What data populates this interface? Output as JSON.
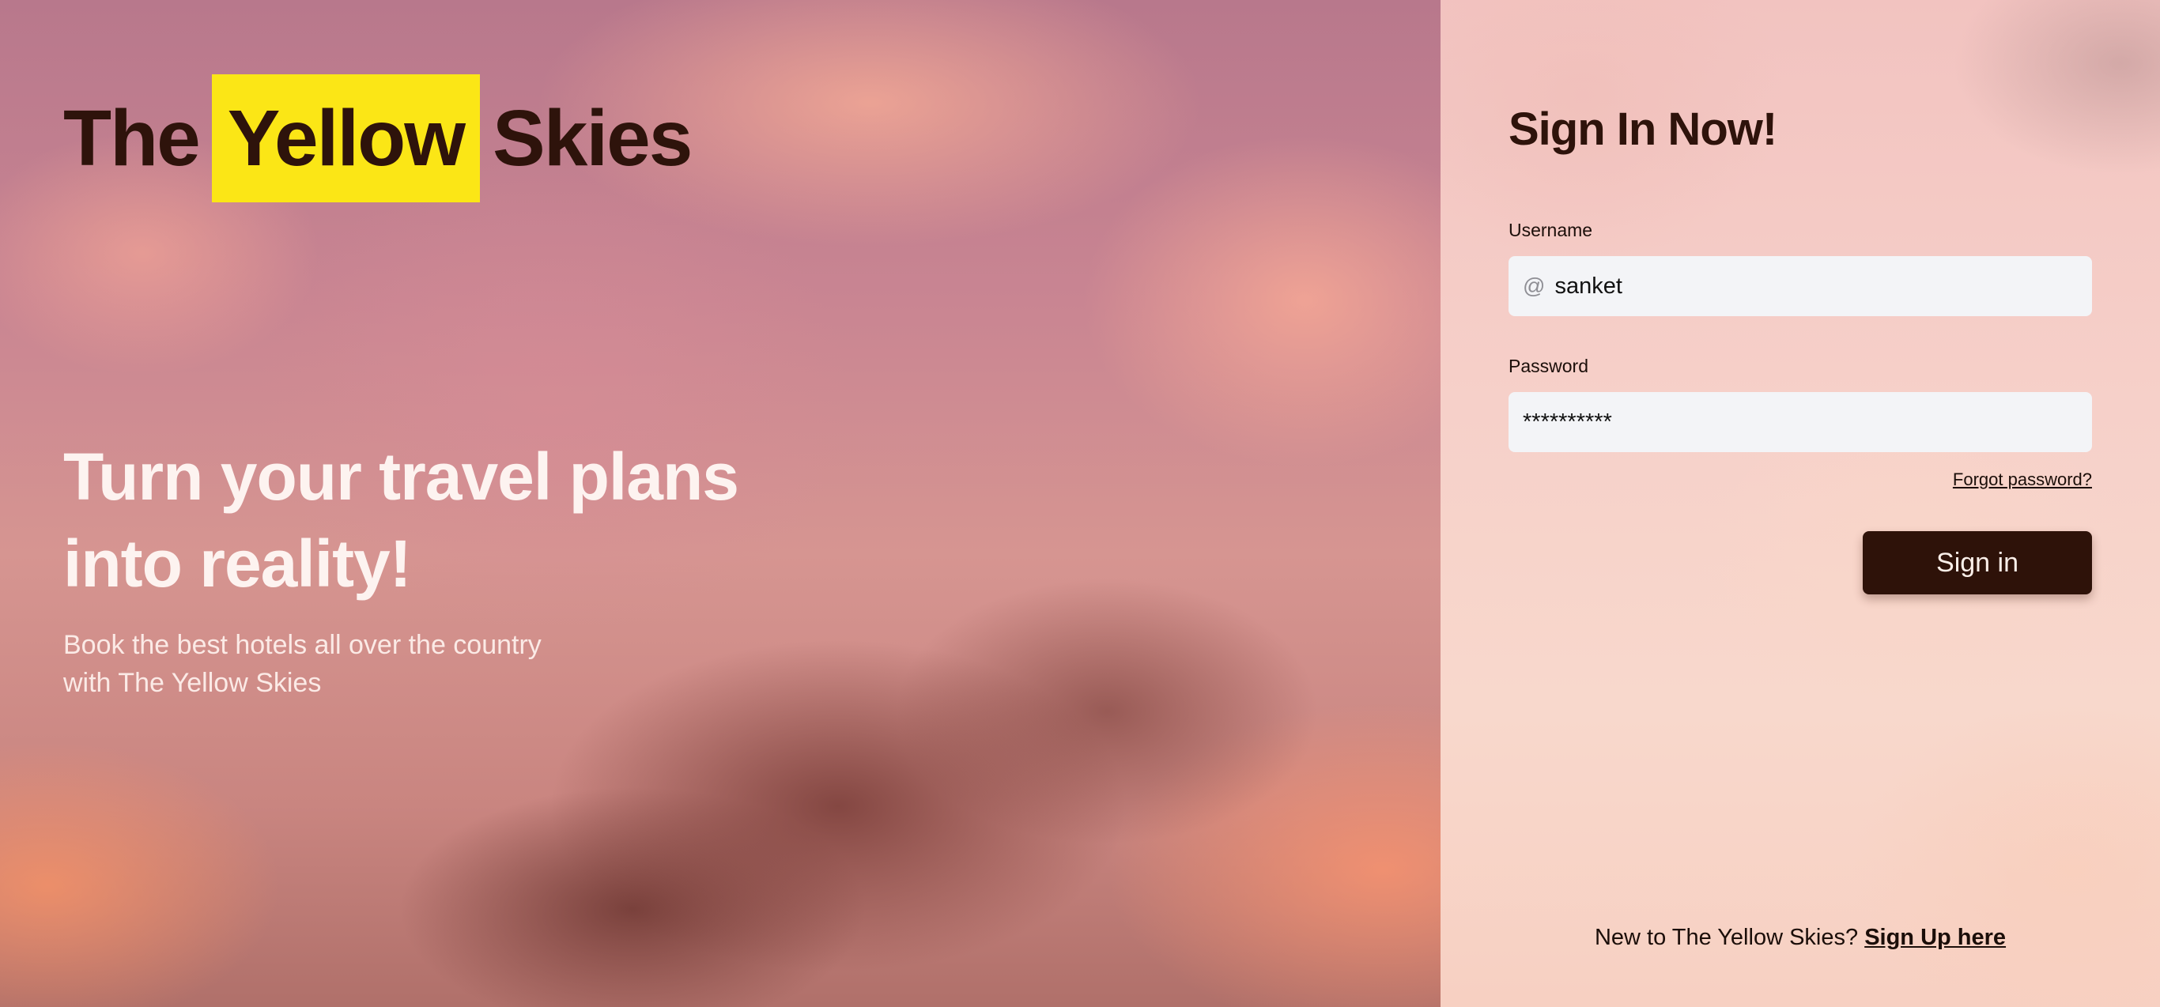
{
  "brand": {
    "word1": "The",
    "highlight": "Yellow",
    "word2": "Skies",
    "highlight_color": "#fbe616",
    "text_color": "#2e130b"
  },
  "hero": {
    "headline_line1": "Turn your travel plans",
    "headline_line2": "into reality!",
    "sub_line1": "Book the best hotels all over the country",
    "sub_line2": "with The Yellow Skies"
  },
  "signin": {
    "title": "Sign In Now!",
    "username": {
      "label": "Username",
      "icon": "at-icon",
      "icon_glyph": "@",
      "value": "sanket"
    },
    "password": {
      "label": "Password",
      "value": "**********"
    },
    "forgot_label": "Forgot password?",
    "button_label": "Sign in",
    "button_color": "#2e1209",
    "signup_prompt": "New to The Yellow Skies?",
    "signup_link": "Sign Up here"
  }
}
